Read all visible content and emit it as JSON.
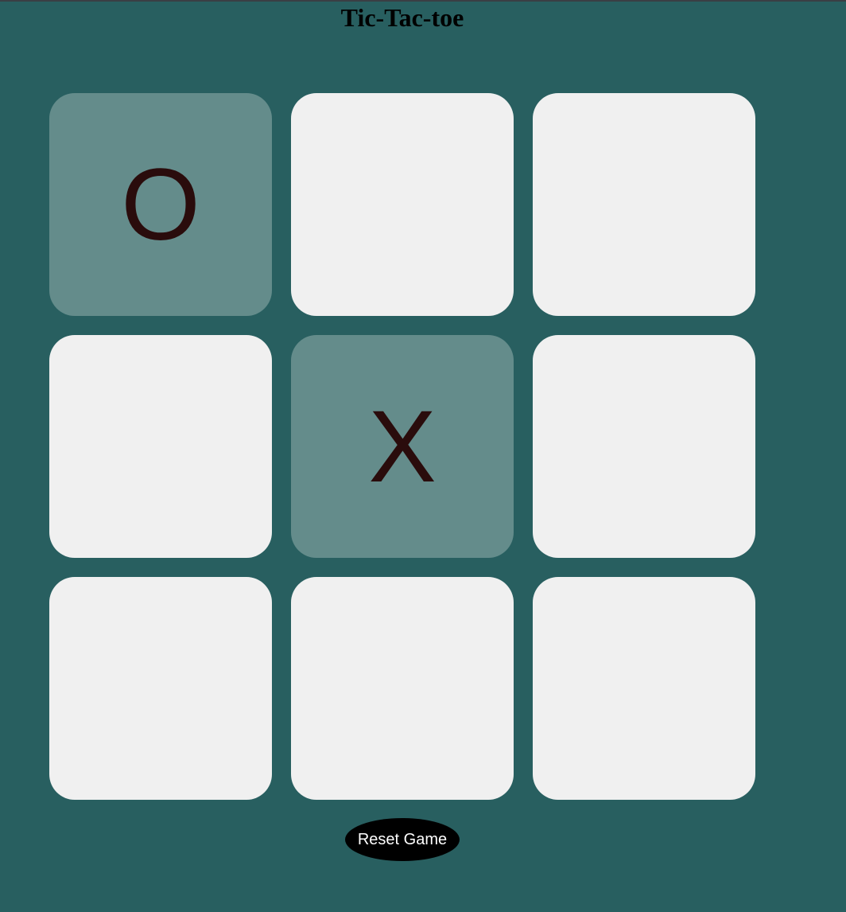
{
  "title": "Tic-Tac-toe",
  "board": {
    "cells": [
      "O",
      "",
      "",
      "",
      "X",
      "",
      "",
      "",
      ""
    ]
  },
  "reset_label": "Reset Game",
  "colors": {
    "background": "#285f60",
    "cell_empty": "#f0f0f0",
    "cell_filled": "#648c8b",
    "mark": "#2a0c0c",
    "button": "#000000"
  }
}
